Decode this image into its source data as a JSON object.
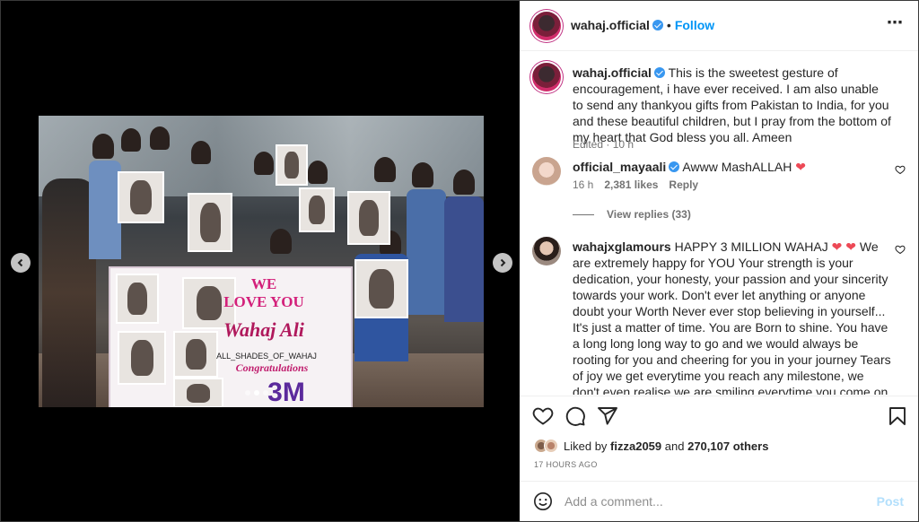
{
  "post": {
    "author": "wahaj.official",
    "follow_label": "Follow",
    "separator": "•",
    "more_icon": "⋯"
  },
  "media": {
    "banner": {
      "line1": "WE",
      "line2": "LOVE YOU",
      "line3": "Wahaj Ali",
      "line4": "ALL_SHADES_OF_WAHAJ",
      "line5": "Congratulations",
      "line6": "3M"
    },
    "carousel_dots": 3,
    "active_dot": 2
  },
  "caption": {
    "author": "wahaj.official",
    "text": "This is the sweetest gesture of encouragement, i have ever received. I am also unable to send any thankyou gifts from Pakistan to India, for you and these beautiful children, but I pray from the bottom of my heart that God bless you all. Ameen",
    "meta": "Edited · 10 h"
  },
  "comments": [
    {
      "author": "official_mayaali",
      "text": "Awww MashALLAH",
      "emoji": "❤",
      "time": "16 h",
      "likes": "2,381 likes",
      "reply": "Reply",
      "view_replies": "View replies (33)"
    },
    {
      "author": "wahajxglamours",
      "text": "HAPPY 3 MILLION WAHAJ",
      "emoji": "❤ ❤",
      "body": "We are extremely happy for YOU Your strength is your dedication, your honesty, your passion and your sincerity towards your work. Don't ever let anything or anyone doubt your Worth Never ever stop believing in yourself... It's just a matter of time. You are Born to shine. You have a long long long way to go and we would always be rooting for you and cheering for you in your journey Tears of joy we get everytime you reach any milestone, we don't even realise we are smiling everytime you come on our mobile screens, remembering you in our prayers whenever we feel you aren't okay. When we say"
    }
  ],
  "likes": {
    "prefix": "Liked by",
    "user": "fizza2059",
    "mid": "and",
    "count": "270,107 others"
  },
  "timestamp": "17 HOURS AGO",
  "add_comment": {
    "placeholder": "Add a comment...",
    "post_label": "Post"
  },
  "colors": {
    "link_blue": "#0095f6",
    "heart_red": "#ed4956",
    "verified_blue": "#3897f0",
    "post_disabled": "#b2dffc"
  }
}
